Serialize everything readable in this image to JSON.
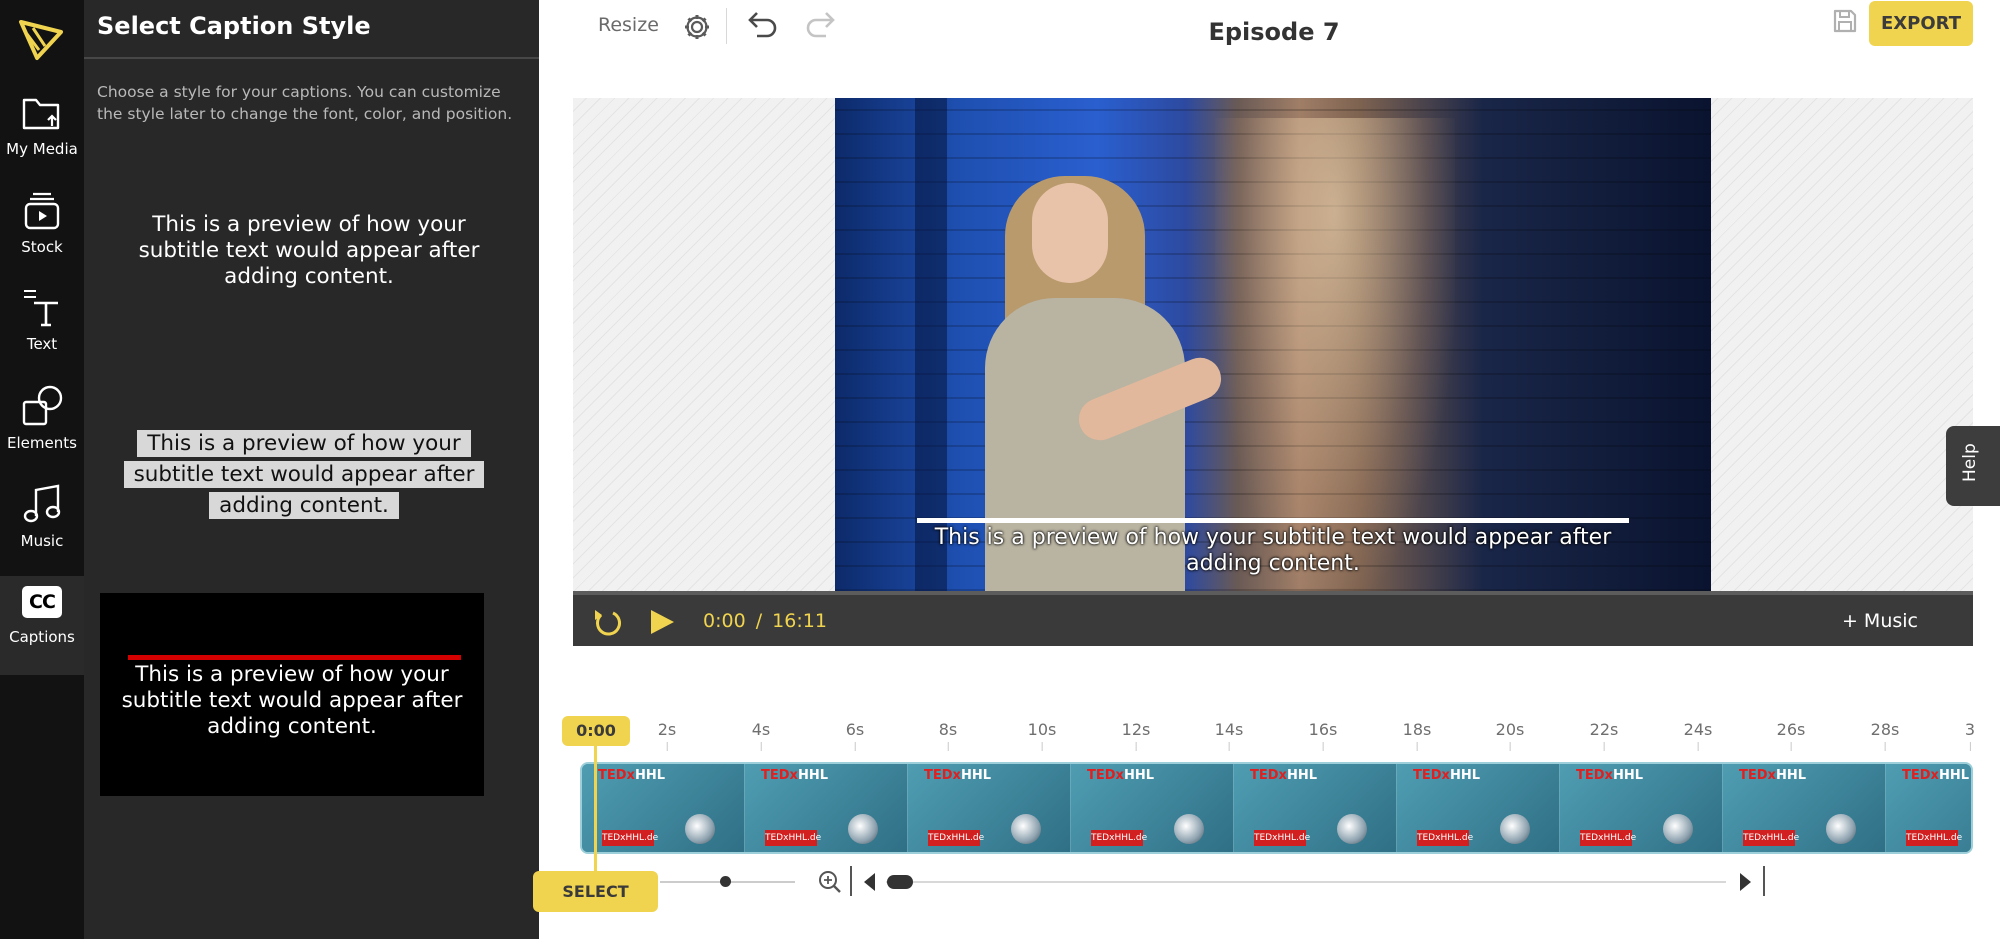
{
  "app": {
    "brand_color": "#f0d34e"
  },
  "rail": {
    "items": [
      {
        "label": "My Media",
        "icon": "folder-upload-icon"
      },
      {
        "label": "Stock",
        "icon": "stock-video-icon"
      },
      {
        "label": "Text",
        "icon": "text-icon"
      },
      {
        "label": "Elements",
        "icon": "shapes-icon"
      },
      {
        "label": "Music",
        "icon": "music-note-icon"
      },
      {
        "label": "Captions",
        "icon": "captions-cc-icon",
        "badge": "CC",
        "active": true
      }
    ]
  },
  "panel": {
    "title": "Select Caption Style",
    "description": "Choose a style for your captions. You can customize the style later to change the font, color, and position.",
    "styles": [
      {
        "preview_text": "This is a preview of how your subtitle text would appear after adding content."
      },
      {
        "preview_lines": [
          "This is a preview of how your",
          "subtitle text would appear after",
          "adding content."
        ]
      },
      {
        "preview_text": "This is a preview of how your subtitle text would appear after adding content."
      }
    ]
  },
  "toolbar": {
    "resize_label": "Resize",
    "project_title": "Episode 7",
    "export_label": "EXPORT"
  },
  "preview": {
    "caption_text": "This is a preview of how your subtitle text would appear after adding content."
  },
  "player": {
    "time_current": "0:00",
    "time_separator": "/",
    "time_total": "16:11",
    "add_music_label": "+ Music"
  },
  "timeline": {
    "playhead_label": "0:00",
    "ticks": [
      "2s",
      "4s",
      "6s",
      "8s",
      "10s",
      "12s",
      "14s",
      "16s",
      "18s",
      "20s",
      "22s",
      "24s",
      "26s",
      "28s",
      "3"
    ],
    "thumbnail_text_red": "TEDx",
    "thumbnail_text_white": "HHL",
    "thumbnail_badge": "TEDxHHL.de",
    "select_label": "SELECT"
  },
  "help": {
    "label": "Help"
  }
}
